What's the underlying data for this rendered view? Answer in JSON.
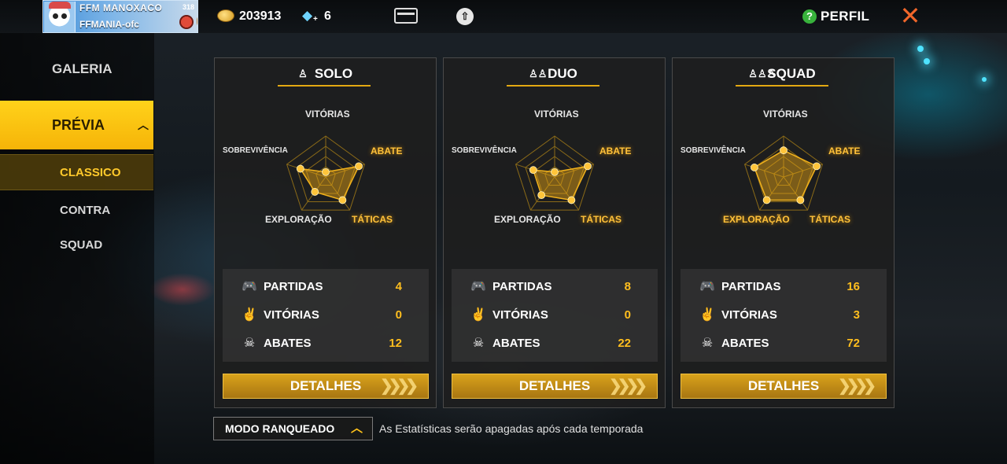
{
  "profile": {
    "name": "FFM    MANOXACO",
    "guild": "FFMANIA-ofc",
    "level": "318"
  },
  "currency": {
    "coins": "203913",
    "diamonds": "6",
    "diamond_plus": "+"
  },
  "header": {
    "perfil_label": "PERFIL",
    "help_symbol": "?",
    "close_symbol": "✕"
  },
  "sidebar": {
    "galeria": "GALERIA",
    "previa": "PRÉVIA",
    "previa_chevron": "︿",
    "classico": "CLASSICO",
    "contra_squad": "CONTRA SQUAD"
  },
  "radar_labels": {
    "vitorias": "VITÓRIAS",
    "abate": "ABATE",
    "taticas": "TÁTICAS",
    "exploracao": "EXPLORAÇÃO",
    "sobrevivencia": "SOBREVIVÊNCIA"
  },
  "panels": [
    {
      "mode": "SOLO",
      "icon": "solo-icon",
      "icon_glyph": "♙",
      "radar": {
        "vitorias": 0.12,
        "abate": 0.85,
        "taticas": 0.7,
        "exploracao": 0.45,
        "sobrevivencia": 0.65
      },
      "highlight": [
        "abate",
        "taticas"
      ],
      "stats": [
        {
          "icon": "controller-icon",
          "glyph": "🎮",
          "label": "PARTIDAS",
          "value": "4"
        },
        {
          "icon": "victory-hand-icon",
          "glyph": "✌",
          "label": "VITÓRIAS",
          "value": "0"
        },
        {
          "icon": "skull-icon",
          "glyph": "☠",
          "label": "ABATES",
          "value": "12"
        }
      ],
      "button": "DETALHES"
    },
    {
      "mode": "DUO",
      "icon": "duo-icon",
      "icon_glyph": "♙♙",
      "radar": {
        "vitorias": 0.12,
        "abate": 0.85,
        "taticas": 0.7,
        "exploracao": 0.55,
        "sobrevivencia": 0.55
      },
      "highlight": [
        "abate",
        "taticas"
      ],
      "stats": [
        {
          "icon": "controller-icon",
          "glyph": "🎮",
          "label": "PARTIDAS",
          "value": "8"
        },
        {
          "icon": "victory-hand-icon",
          "glyph": "✌",
          "label": "VITÓRIAS",
          "value": "0"
        },
        {
          "icon": "skull-icon",
          "glyph": "☠",
          "label": "ABATES",
          "value": "22"
        }
      ],
      "button": "DETALHES"
    },
    {
      "mode": "SQUAD",
      "icon": "squad-icon",
      "icon_glyph": "♙♙♙",
      "radar": {
        "vitorias": 0.65,
        "abate": 0.85,
        "taticas": 0.7,
        "exploracao": 0.7,
        "sobrevivencia": 0.75
      },
      "highlight": [
        "abate",
        "taticas",
        "exploracao"
      ],
      "stats": [
        {
          "icon": "controller-icon",
          "glyph": "🎮",
          "label": "PARTIDAS",
          "value": "16"
        },
        {
          "icon": "victory-hand-icon",
          "glyph": "✌",
          "label": "VITÓRIAS",
          "value": "3"
        },
        {
          "icon": "skull-icon",
          "glyph": "☠",
          "label": "ABATES",
          "value": "72"
        }
      ],
      "button": "DETALHES"
    }
  ],
  "footer": {
    "mode_select": "MODO RANQUEADO",
    "mode_chevron": "︿",
    "notice": "As Estatísticas serão apagadas após cada temporada"
  },
  "colors": {
    "accent": "#f6b408",
    "value": "#ffbe1e",
    "close": "#f0662a",
    "help": "#38b23c"
  }
}
